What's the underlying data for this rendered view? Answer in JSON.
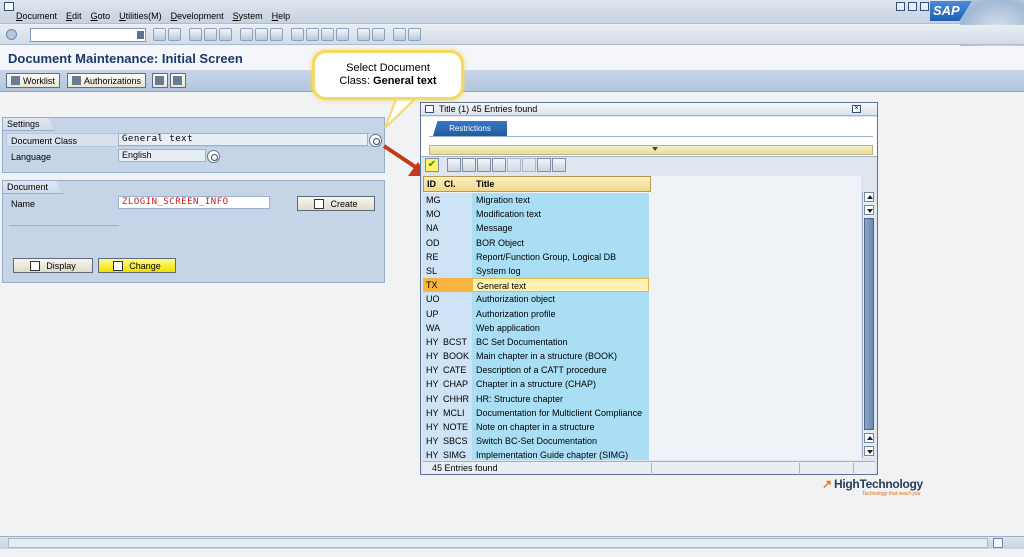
{
  "menu": [
    "Document",
    "Edit",
    "Goto",
    "Utilities(M)",
    "Development",
    "System",
    "Help"
  ],
  "logo": "SAP",
  "page_title": "Document Maintenance: Initial Screen",
  "app_toolbar": {
    "worklist": "Worklist",
    "authorizations": "Authorizations"
  },
  "callout": {
    "line1": "Select Document",
    "line2_prefix": "Class: ",
    "line2_bold": "General text"
  },
  "settings": {
    "header": "Settings",
    "doc_class_label": "Document Class",
    "doc_class_value": "General text",
    "language_label": "Language",
    "language_value": "English"
  },
  "document": {
    "header": "Document",
    "name_label": "Name",
    "name_value": "ZLOGIN_SCREEN_INFO",
    "create": "Create",
    "display": "Display",
    "change": "Change"
  },
  "popup": {
    "title": "Title (1)   45 Entries found",
    "restrictions_tab": "Restrictions",
    "columns": {
      "id": "ID",
      "cl": "Cl.",
      "title": "Title"
    },
    "rows": [
      {
        "id": "MG",
        "cl": "",
        "title": "Migration text"
      },
      {
        "id": "MO",
        "cl": "",
        "title": "Modification text"
      },
      {
        "id": "NA",
        "cl": "",
        "title": "Message"
      },
      {
        "id": "OD",
        "cl": "",
        "title": "BOR Object"
      },
      {
        "id": "RE",
        "cl": "",
        "title": "Report/Function Group, Logical DB"
      },
      {
        "id": "SL",
        "cl": "",
        "title": "System log"
      },
      {
        "id": "TX",
        "cl": "",
        "title": "General text",
        "selected": true
      },
      {
        "id": "UO",
        "cl": "",
        "title": "Authorization object"
      },
      {
        "id": "UP",
        "cl": "",
        "title": "Authorization profile"
      },
      {
        "id": "WA",
        "cl": "",
        "title": "Web application"
      },
      {
        "id": "HY",
        "cl": "BCST",
        "title": "BC Set Documentation"
      },
      {
        "id": "HY",
        "cl": "BOOK",
        "title": "Main chapter in a structure (BOOK)"
      },
      {
        "id": "HY",
        "cl": "CATE",
        "title": "Description of a CATT procedure"
      },
      {
        "id": "HY",
        "cl": "CHAP",
        "title": "Chapter in a structure (CHAP)"
      },
      {
        "id": "HY",
        "cl": "CHHR",
        "title": "HR: Structure chapter"
      },
      {
        "id": "HY",
        "cl": "MCLI",
        "title": "Documentation for Multiclient Compliance"
      },
      {
        "id": "HY",
        "cl": "NOTE",
        "title": "Note on chapter in a structure"
      },
      {
        "id": "HY",
        "cl": "SBCS",
        "title": "Switch BC-Set Documentation"
      },
      {
        "id": "HY",
        "cl": "SIMG",
        "title": "Implementation Guide chapter (SIMG)"
      }
    ],
    "status": "45 Entries found"
  },
  "watermark": {
    "name": "HighTechnology",
    "tagline": "Technology that reach you"
  }
}
